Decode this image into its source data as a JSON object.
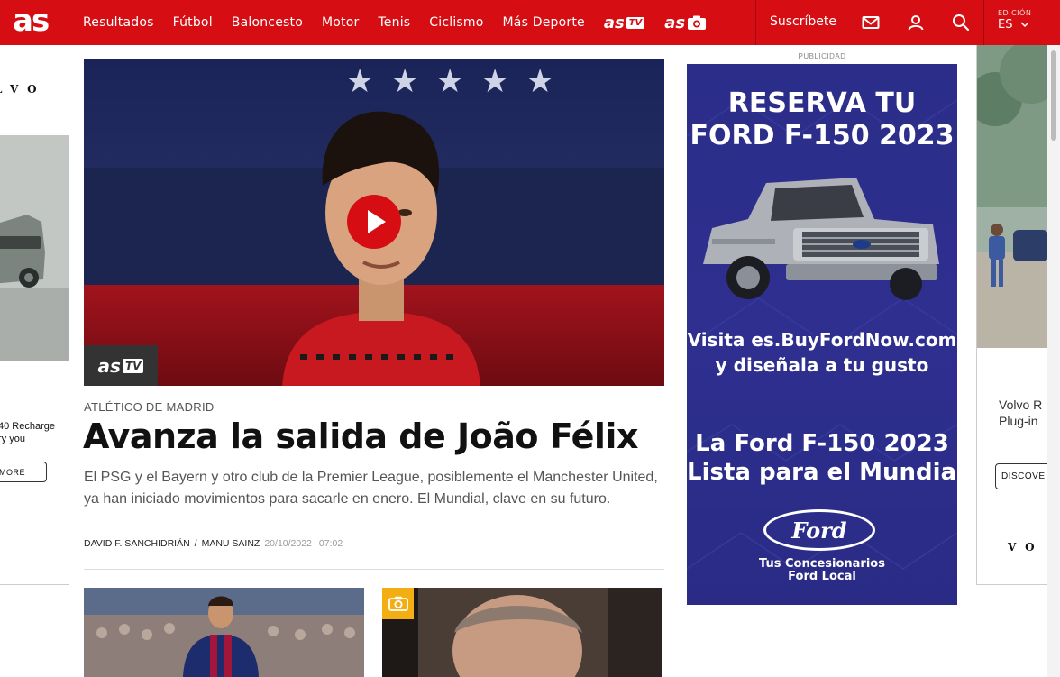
{
  "header": {
    "logo": "as",
    "nav": [
      "Resultados",
      "Fútbol",
      "Baloncesto",
      "Motor",
      "Tenis",
      "Ciclismo",
      "Más Deporte"
    ],
    "astv": {
      "prefix": "as",
      "box": "TV"
    },
    "asfoto": {
      "prefix": "as"
    },
    "subscribe_label": "Suscríbete",
    "edition_label": "EDICIÓN",
    "edition_value": "ES",
    "brand_color": "#d60d12"
  },
  "left_ad": {
    "brand": "LVO",
    "text_line1": "40 Recharge",
    "text_line2": "ry you",
    "button": "MORE"
  },
  "right_ad": {
    "text_line1": "Volvo R",
    "text_line2": "Plug-in",
    "button": "DISCOVE",
    "brand": "VO"
  },
  "article": {
    "kicker": "ATLÉTICO DE MADRID",
    "headline": "Avanza la salida de João Félix",
    "summary": "El PSG y el Bayern y otro club de la Premier League, posiblemente el Manchester United, ya han iniciado movimientos para sacarle en enero. El Mundial, clave en su futuro.",
    "author1": "DAVID F. SANCHIDRIÁN",
    "separator": "/",
    "author2": "MANU SAINZ",
    "date": "20/10/2022",
    "time": "07:02",
    "video_badge": {
      "prefix": "as",
      "box": "TV"
    }
  },
  "ad": {
    "label": "PUBLICIDAD",
    "line1": "RESERVA TU",
    "line2": "FORD F-150 2023",
    "line3": "Visita es.BuyFordNow.com",
    "line4": "y diseñala a tu gusto",
    "line5": "La Ford F-150 2023",
    "line6": "Lista para el Mundial",
    "logo": "Ford",
    "footer1": "Tus Concesionarios",
    "footer2": "Ford Local",
    "bg_color": "#2b2d89"
  },
  "icons": {
    "mail": "mail-icon",
    "user": "user-icon",
    "search": "search-icon",
    "chevron": "chevron-down-icon",
    "camera": "camera-icon",
    "play": "play-icon"
  }
}
